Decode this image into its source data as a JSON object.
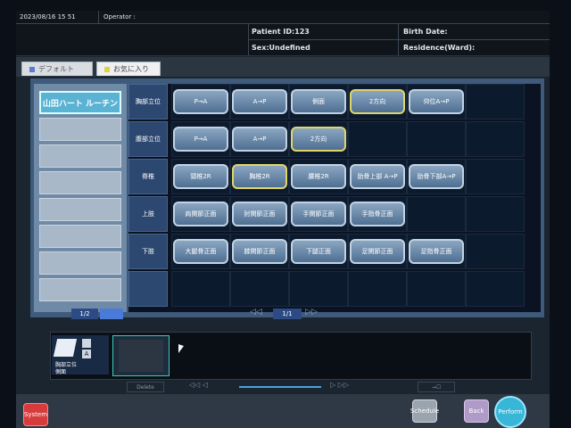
{
  "header": {
    "datetime": "2023/08/16 15 51",
    "operator_label": "Operator :",
    "patient_id": "Patient ID:123",
    "birth_date": "Birth Date:",
    "sex": "Sex:Undefined",
    "residence": "Residence(Ward):"
  },
  "tabs": [
    {
      "label": "デフォルト",
      "color": "#5b7bd1"
    },
    {
      "label": "お気に入り",
      "color": "#e0d23b"
    }
  ],
  "left_panel": {
    "first_item": "山田ハート ルーチン"
  },
  "grid_rows": [
    {
      "label": "胸部立位",
      "buttons": [
        "P→A",
        "A→P",
        "側面",
        "2方向",
        "仰位A→P"
      ],
      "highlight": [
        3
      ]
    },
    {
      "label": "腹部立位",
      "buttons": [
        "P→A",
        "A→P",
        "2方向"
      ],
      "highlight": [
        2
      ]
    },
    {
      "label": "脊椎",
      "buttons": [
        "頸椎2R",
        "胸椎2R",
        "腰椎2R",
        "肋骨上部 A→P",
        "肋骨下部A→P"
      ],
      "highlight": [
        1
      ]
    },
    {
      "label": "上肢",
      "buttons": [
        "肩関節正面",
        "肘関節正面",
        "手関節正面",
        "手指骨正面"
      ],
      "highlight": []
    },
    {
      "label": "下肢",
      "buttons": [
        "大腿骨正面",
        "膝関節正面",
        "下腿正面",
        "足関節正面",
        "足指骨正面"
      ],
      "highlight": []
    }
  ],
  "pagination": {
    "left_page": "1/2",
    "grid_page": "1/1"
  },
  "thumbnail": {
    "label_line1": "胸部立位",
    "label_line2": "側面"
  },
  "bottom": {
    "system": "System",
    "schedule": "Schedule",
    "back": "Back",
    "perform": "Perform",
    "delete": "Delete"
  }
}
